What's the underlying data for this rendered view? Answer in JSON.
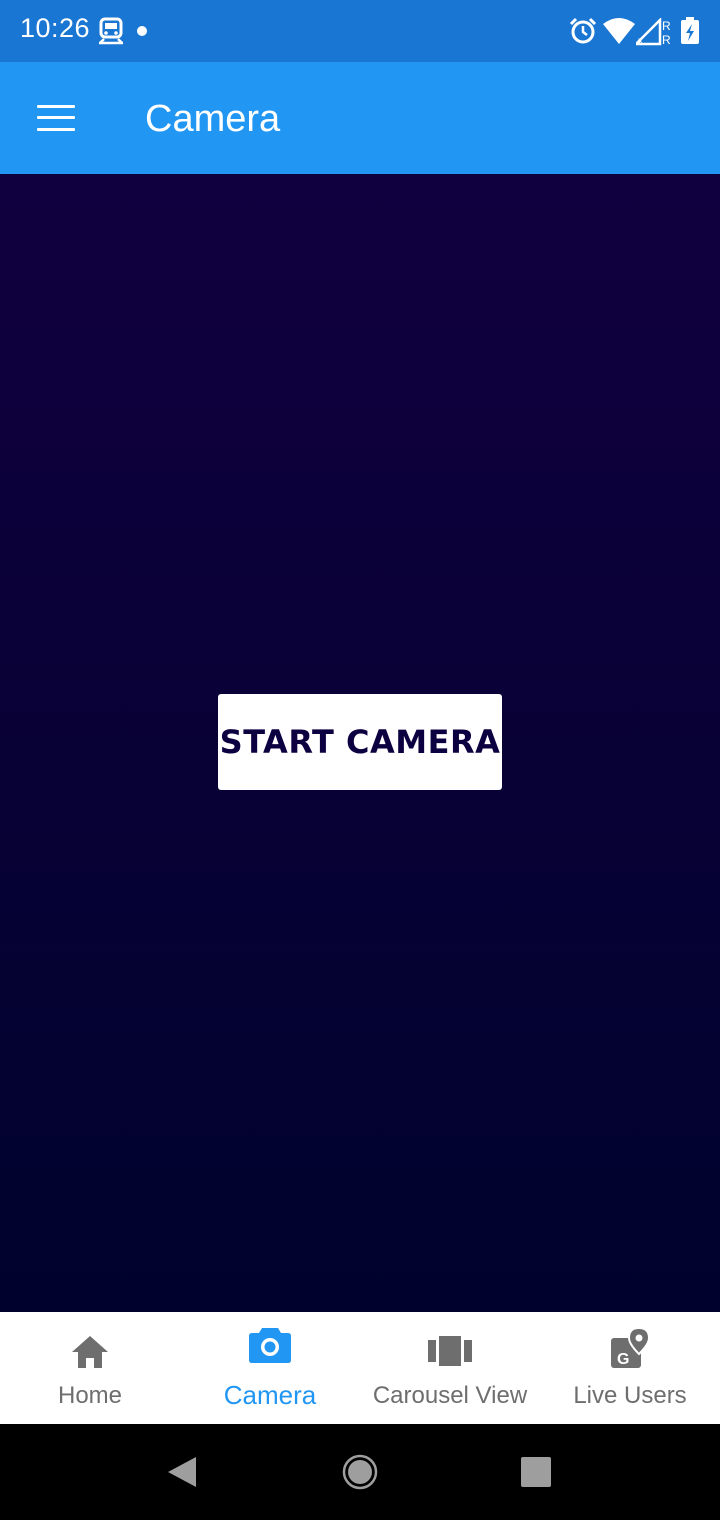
{
  "status_bar": {
    "time": "10:26",
    "icons": [
      "train-icon",
      "notification-dot-icon",
      "alarm-icon",
      "wifi-icon",
      "signal-icon",
      "battery-charging-icon"
    ]
  },
  "app_bar": {
    "title": "Camera",
    "menu_icon": "hamburger-menu-icon",
    "color": "#2196f3"
  },
  "content": {
    "background_top": "#11003f",
    "background_bottom": "#00022d",
    "start_button_label": "START CAMERA"
  },
  "bottom_nav": {
    "active_color": "#2196f3",
    "inactive_color": "#6e6e6e",
    "items": [
      {
        "label": "Home",
        "icon": "home-icon",
        "active": false
      },
      {
        "label": "Camera",
        "icon": "camera-icon",
        "active": true
      },
      {
        "label": "Carousel View",
        "icon": "carousel-icon",
        "active": false
      },
      {
        "label": "Live Users",
        "icon": "map-location-icon",
        "active": false
      }
    ]
  },
  "system_nav": {
    "icons": [
      "back-icon",
      "home-circle-icon",
      "recents-icon"
    ]
  }
}
